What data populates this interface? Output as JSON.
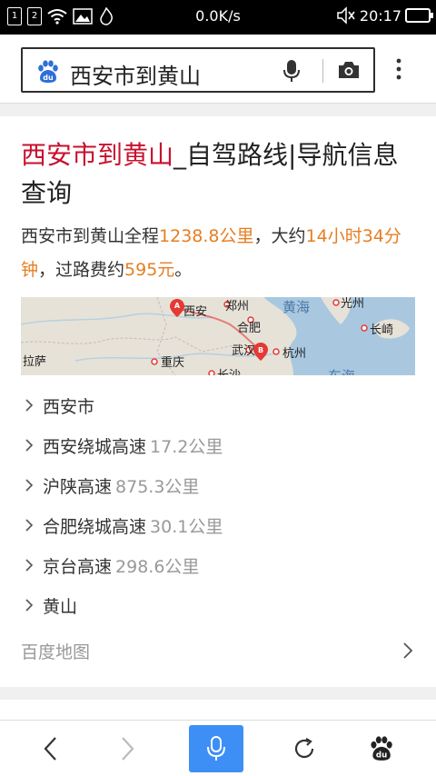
{
  "status_bar": {
    "sim1": "1",
    "sim2": "2",
    "net_speed": "0.0K/s",
    "time": "20:17",
    "battery_level": 0.9
  },
  "search": {
    "query": "西安市到黄山"
  },
  "result": {
    "title_highlight": "西安市到黄山",
    "title_rest": "_自驾路线|导航信息查询",
    "summary": {
      "prefix": "西安市到黄山全程",
      "distance": "1238.8公里",
      "mid": "，大约",
      "duration": "14小时34分钟",
      "mid2": "，过路费约",
      "toll": "595元",
      "suffix": "。"
    },
    "map_labels": {
      "xian": "西安",
      "zhengzhou": "郑州",
      "huanghai": "黄海",
      "guangzhou": "光州",
      "hefei": "合肥",
      "changqi": "长崎",
      "lasa": "拉萨",
      "chongqing": "重庆",
      "wuhan": "武汉",
      "hangzhou": "杭州",
      "changsha": "长沙",
      "donghai": "东海",
      "marker_a": "A",
      "marker_b": "B"
    },
    "steps": [
      {
        "name": "西安市",
        "distance": ""
      },
      {
        "name": "西安绕城高速",
        "distance": "17.2公里"
      },
      {
        "name": "沪陕高速",
        "distance": "875.3公里"
      },
      {
        "name": "合肥绕城高速",
        "distance": "30.1公里"
      },
      {
        "name": "京台高速",
        "distance": "298.6公里"
      },
      {
        "name": "黄山",
        "distance": ""
      }
    ],
    "source": "百度地图"
  },
  "colors": {
    "title_highlight": "#c8102e",
    "number_highlight": "#e67e22",
    "mic_button": "#3d8ff5",
    "baidu_blue": "#2e6fd8"
  }
}
